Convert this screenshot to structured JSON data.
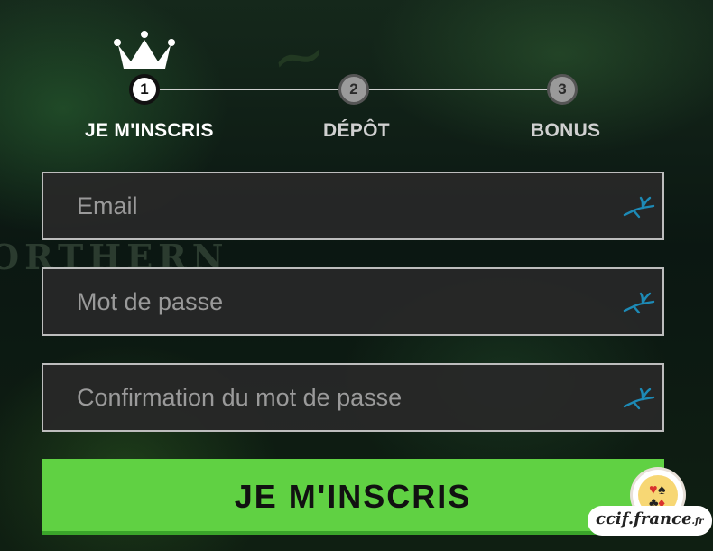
{
  "background": {
    "brand_word": "ORTHERN"
  },
  "stepper": {
    "steps": [
      {
        "number": "1",
        "label": "JE M'INSCRIS",
        "state": "active"
      },
      {
        "number": "2",
        "label": "DÉPÔT",
        "state": "inactive"
      },
      {
        "number": "3",
        "label": "BONUS",
        "state": "inactive"
      }
    ],
    "active_icon": "crown-icon"
  },
  "form": {
    "email": {
      "placeholder": "Email",
      "value": "",
      "icon": "deer-leap-icon"
    },
    "password": {
      "placeholder": "Mot de passe",
      "value": "",
      "icon": "deer-leap-icon"
    },
    "confirm": {
      "placeholder": "Confirmation du mot de passe",
      "value": "",
      "icon": "deer-leap-icon"
    },
    "submit_label": "JE M'INSCRIS"
  },
  "watermark": {
    "text": "ccif.france",
    "suffix": ".fr"
  },
  "colors": {
    "accent_green": "#60d143",
    "field_icon_blue": "#1d8ab6",
    "active_step": "#ffffff",
    "inactive_step": "#9a9a9a"
  }
}
